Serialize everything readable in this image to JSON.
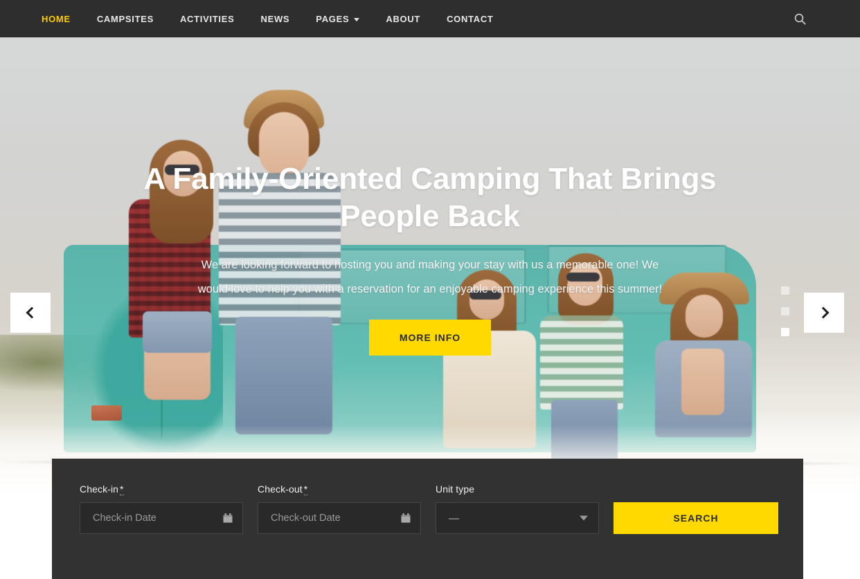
{
  "nav": {
    "items": [
      {
        "label": "HOME",
        "active": true,
        "has_caret": false
      },
      {
        "label": "CAMPSITES",
        "active": false,
        "has_caret": false
      },
      {
        "label": "ACTIVITIES",
        "active": false,
        "has_caret": false
      },
      {
        "label": "NEWS",
        "active": false,
        "has_caret": false
      },
      {
        "label": "PAGES",
        "active": false,
        "has_caret": true
      },
      {
        "label": "ABOUT",
        "active": false,
        "has_caret": false
      },
      {
        "label": "CONTACT",
        "active": false,
        "has_caret": false
      }
    ],
    "search_icon": "search-icon",
    "active_color": "#ffcc00",
    "bar_color": "#2e2e2e",
    "link_color": "#e8e8e8"
  },
  "hero": {
    "title": "A Family-Oriented Camping That Brings People Back",
    "subtitle": "We are looking forward to hosting you and making your stay with us a memorable one! We would love to help you with a reservation for an enjoyable camping experience this summer!",
    "cta_label": "MORE INFO",
    "cta_color": "#ffd900",
    "prev_icon": "chevron-left-icon",
    "next_icon": "chevron-right-icon",
    "slides": [
      {
        "index": 1,
        "active": false
      },
      {
        "index": 2,
        "active": false
      },
      {
        "index": 3,
        "active": true
      }
    ]
  },
  "booking": {
    "panel_color": "#323232",
    "checkin": {
      "label": "Check-in",
      "required_marker": "*",
      "placeholder": "Check-in Date",
      "value": "",
      "icon": "calendar-icon"
    },
    "checkout": {
      "label": "Check-out",
      "required_marker": "*",
      "placeholder": "Check-out Date",
      "value": "",
      "icon": "calendar-icon"
    },
    "unit_type": {
      "label": "Unit type",
      "selected": "—",
      "icon": "chevron-down-icon"
    },
    "search_label": "SEARCH",
    "search_color": "#ffd900"
  }
}
